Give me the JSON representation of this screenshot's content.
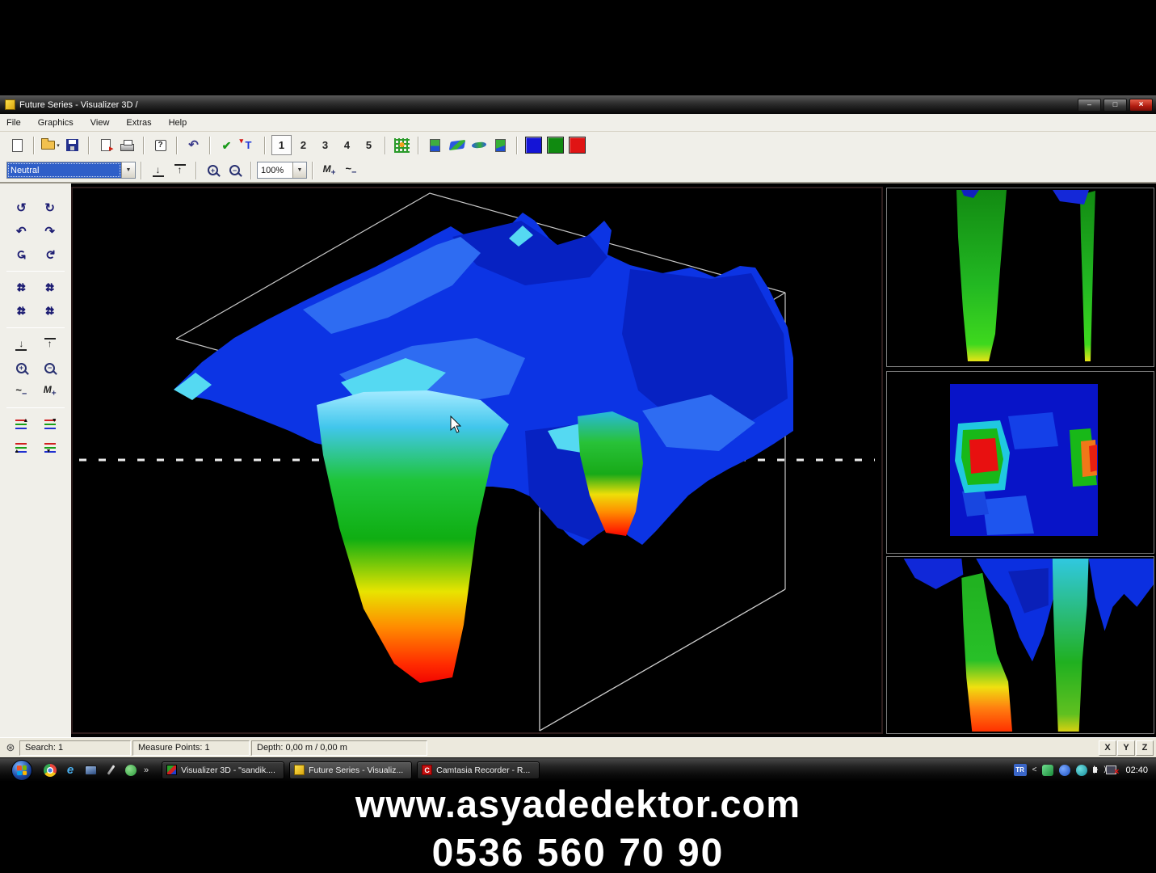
{
  "window": {
    "title": "Future Series - Visualizer 3D /",
    "controls": [
      "minimize-icon",
      "restore-icon",
      "close-icon"
    ]
  },
  "menubar": {
    "items": [
      "File",
      "Graphics",
      "View",
      "Extras",
      "Help"
    ]
  },
  "toolbar": {
    "icons": [
      "new",
      "open",
      "save",
      "export",
      "print",
      "help",
      "undo",
      "apply-check",
      "probe",
      "grid",
      "view-image",
      "view-3d-surface",
      "view-flat",
      "view-profile"
    ],
    "scan_buttons": [
      "1",
      "2",
      "3",
      "4",
      "5"
    ],
    "active_scan": "1",
    "color_buttons": [
      "#1414d6",
      "#108a10",
      "#e01414"
    ]
  },
  "toolbar2": {
    "mode_select": {
      "value": "Neutral"
    },
    "zoom_select": {
      "value": "100%"
    },
    "icons": [
      "limit-down",
      "limit-up",
      "zoom-in",
      "zoom-out",
      "signal-minus",
      "signal-plus"
    ]
  },
  "sidebar": {
    "icons": [
      "rotate-back",
      "rotate-forward",
      "turn-left",
      "turn-right",
      "spin-left",
      "spin-right",
      "move-1",
      "move-2",
      "move-3",
      "move-4",
      "limit-down",
      "limit-up",
      "zoom-in",
      "zoom-out",
      "signal-minus",
      "signal-plus",
      "layers-shift-up",
      "layers-shift-down",
      "layers-step-up",
      "layers-step-down"
    ]
  },
  "statusbar": {
    "search": "Search: 1",
    "measure_points": "Measure Points: 1",
    "depth": "Depth: 0,00 m / 0,00 m",
    "axis_buttons": [
      "X",
      "Y",
      "Z"
    ]
  },
  "taskbar": {
    "quick_launch": [
      "chrome",
      "internet-explorer",
      "display",
      "pen",
      "messenger"
    ],
    "overflow_chevron": "»",
    "tasks": [
      {
        "label": "Visualizer 3D - \"sandik...."
      },
      {
        "label": "Future Series - Visualiz...",
        "active": true
      },
      {
        "label": "Camtasia Recorder - R..."
      }
    ],
    "tray": {
      "language": "TR",
      "collapse": "<",
      "clock": "02:40"
    }
  },
  "overlay": {
    "line1": "www.asyadedektor.com",
    "line2": "0536 560 70 90"
  },
  "scene": {
    "palette": [
      "#0c34e4",
      "#55d9f2",
      "#1fc53a",
      "#e8e400",
      "#ff8c00",
      "#f00000"
    ],
    "wireframe_color": "#c8c8c8",
    "depth_line_style": "dashed-white"
  }
}
